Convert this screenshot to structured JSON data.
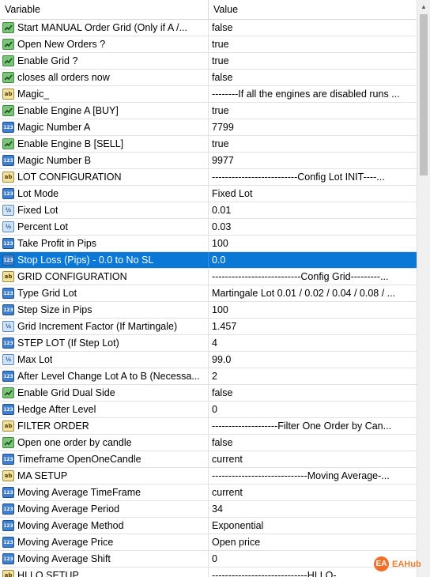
{
  "header": {
    "variable": "Variable",
    "value": "Value"
  },
  "selected_index": 14,
  "rows": [
    {
      "icon": "b",
      "name": "Start MANUAL Order  Grid  (Only if A /...",
      "value": "false"
    },
    {
      "icon": "b",
      "name": "Open New Orders ?",
      "value": "true"
    },
    {
      "icon": "b",
      "name": "Enable Grid ?",
      "value": "true"
    },
    {
      "icon": "b",
      "name": "closes all orders now",
      "value": "false"
    },
    {
      "icon": "s",
      "name": "Magic_",
      "value": "--------If all the engines are disabled runs ..."
    },
    {
      "icon": "b",
      "name": "Enable Engine A   [BUY]",
      "value": "true"
    },
    {
      "icon": "n",
      "name": "Magic Number  A",
      "value": "7799"
    },
    {
      "icon": "b",
      "name": "Enable Engine B   [SELL]",
      "value": "true"
    },
    {
      "icon": "n",
      "name": "Magic Number  B",
      "value": "9977"
    },
    {
      "icon": "s",
      "name": "LOT CONFIGURATION",
      "value": "--------------------------Config Lot INIT----..."
    },
    {
      "icon": "n",
      "name": "Lot Mode",
      "value": "Fixed Lot"
    },
    {
      "icon": "f",
      "name": "Fixed Lot",
      "value": "0.01"
    },
    {
      "icon": "f",
      "name": "Percent Lot",
      "value": "0.03"
    },
    {
      "icon": "n",
      "name": "Take Profit in Pips",
      "value": "100"
    },
    {
      "icon": "n",
      "name": "Stop Loss (Pips) - 0.0 to No SL",
      "value": "0.0"
    },
    {
      "icon": "s",
      "name": "GRID CONFIGURATION",
      "value": "---------------------------Config Grid---------..."
    },
    {
      "icon": "n",
      "name": "Type Grid Lot",
      "value": "Martingale Lot  0.01 / 0.02 / 0.04 / 0.08 / ..."
    },
    {
      "icon": "n",
      "name": "Step Size in Pips",
      "value": "100"
    },
    {
      "icon": "f",
      "name": "Grid Increment Factor (If Martingale)",
      "value": "1.457"
    },
    {
      "icon": "n",
      "name": "STEP LOT (If  Step Lot)",
      "value": "4"
    },
    {
      "icon": "f",
      "name": "Max Lot",
      "value": "99.0"
    },
    {
      "icon": "n",
      "name": "After Level Change Lot A to B (Necessa...",
      "value": "2"
    },
    {
      "icon": "b",
      "name": "Enable Grid Dual Side",
      "value": "false"
    },
    {
      "icon": "n",
      "name": "Hedge After Level",
      "value": "0"
    },
    {
      "icon": "s",
      "name": "FILTER ORDER",
      "value": "--------------------Filter One Order by Can..."
    },
    {
      "icon": "b",
      "name": "Open one order by candle",
      "value": "false"
    },
    {
      "icon": "n",
      "name": "Timeframe OpenOneCandle",
      "value": "current"
    },
    {
      "icon": "s",
      "name": "MA SETUP",
      "value": "-----------------------------Moving Average-..."
    },
    {
      "icon": "n",
      "name": "Moving Average TimeFrame",
      "value": "current"
    },
    {
      "icon": "n",
      "name": "Moving Average Period",
      "value": "34"
    },
    {
      "icon": "n",
      "name": "Moving Average Method",
      "value": "Exponential"
    },
    {
      "icon": "n",
      "name": "Moving Average Price",
      "value": "Open price"
    },
    {
      "icon": "n",
      "name": "Moving Average Shift",
      "value": "0"
    },
    {
      "icon": "s",
      "name": "HI LO SETUP",
      "value": "-----------------------------HI LO-..."
    }
  ],
  "icon_names": {
    "b": "bool-icon",
    "s": "string-icon",
    "n": "integer-icon",
    "f": "double-icon"
  },
  "icon_glyphs": {
    "b": "",
    "s": "ab",
    "n": "123",
    "f": "½"
  },
  "watermark": {
    "text": "EAHub"
  },
  "colors": {
    "selection": "#0a78d7",
    "bool_icon": "#7cc47a",
    "string_icon": "#f2e2a0",
    "int_icon": "#3f7fd0",
    "double_icon": "#cfe2f6"
  }
}
